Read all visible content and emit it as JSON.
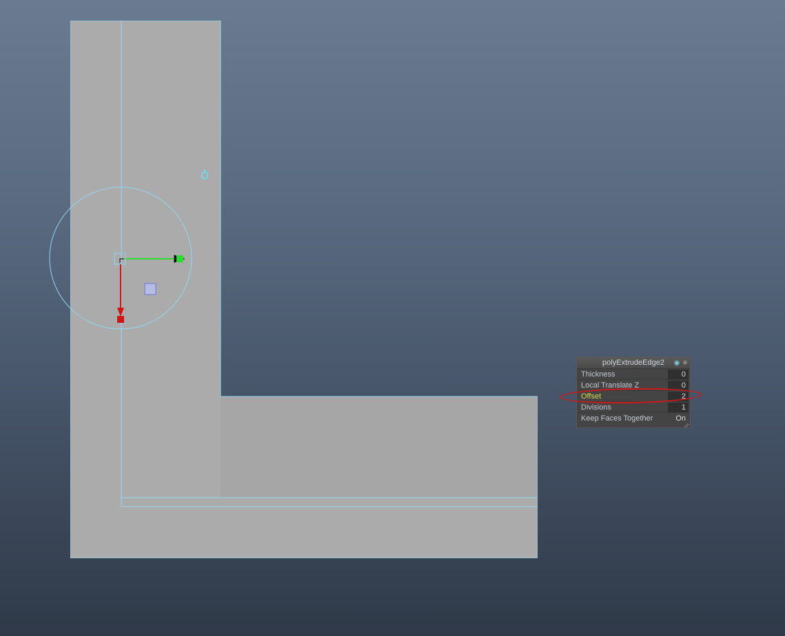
{
  "panel": {
    "title": "polyExtrudeEdge2",
    "rows": [
      {
        "key": "thickness",
        "label": "Thickness",
        "value": "0",
        "highlight": false
      },
      {
        "key": "local_translate_z",
        "label": "Local Translate Z",
        "value": "0",
        "highlight": false
      },
      {
        "key": "offset",
        "label": "Offset",
        "value": "2",
        "highlight": true
      },
      {
        "key": "divisions",
        "label": "Divisions",
        "value": "1",
        "highlight": false
      },
      {
        "key": "keep_faces_together",
        "label": "Keep Faces Together",
        "value": "On",
        "highlight": false,
        "on": true
      }
    ]
  },
  "colors": {
    "edge_selection": "#8fd9f0",
    "axis_x": "#d01414",
    "axis_y": "#2cdc2c",
    "axis_z": "#6a78d8",
    "highlight_ellise": "#d21818"
  }
}
